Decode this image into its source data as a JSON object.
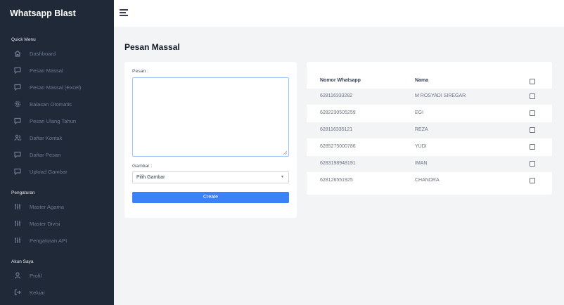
{
  "app": {
    "title": "Whatsapp Blast"
  },
  "sidebar": {
    "sections": [
      {
        "label": "Quick Menu",
        "items": [
          {
            "label": "Dashboard",
            "icon": "home-icon"
          },
          {
            "label": "Pesan Massal",
            "icon": "message-icon"
          },
          {
            "label": "Pesan Massal (Excel)",
            "icon": "message-icon"
          },
          {
            "label": "Balasan Otomatis",
            "icon": "gear-icon"
          },
          {
            "label": "Pesan Ulang Tahun",
            "icon": "message-icon"
          },
          {
            "label": "Daftar Kontak",
            "icon": "users-icon"
          },
          {
            "label": "Daftar Pesan",
            "icon": "message-icon"
          },
          {
            "label": "Upload Gambar",
            "icon": "message-icon"
          }
        ]
      },
      {
        "label": "Pengaturan",
        "items": [
          {
            "label": "Master Agama",
            "icon": "sliders-icon"
          },
          {
            "label": "Master Divisi",
            "icon": "sliders-icon"
          },
          {
            "label": "Pengaturan API",
            "icon": "sliders-icon"
          }
        ]
      },
      {
        "label": "Akun Saya",
        "items": [
          {
            "label": "Profil",
            "icon": "user-icon"
          },
          {
            "label": "Keluar",
            "icon": "logout-icon"
          }
        ]
      }
    ]
  },
  "main": {
    "title": "Pesan Massal",
    "form": {
      "message_label": "Pesan :",
      "message_value": "",
      "image_label": "Gambar :",
      "image_selected": "Pilih Gambar",
      "submit_label": "Create"
    },
    "table": {
      "columns": [
        "Nomor Whatsapp",
        "Nama"
      ],
      "rows": [
        {
          "nomor": "628116333282",
          "nama": "M ROSYADI SIREGAR"
        },
        {
          "nomor": "6282230505259",
          "nama": "EGI"
        },
        {
          "nomor": "628116335121",
          "nama": "REZA"
        },
        {
          "nomor": "6285275000786",
          "nama": "YUDI"
        },
        {
          "nomor": "6283198948191",
          "nama": "IMAN"
        },
        {
          "nomor": "628126551925",
          "nama": "CHANDRA"
        }
      ]
    }
  },
  "colors": {
    "sidebar_bg": "#1f2937",
    "accent": "#3b82f6",
    "page_bg": "#f3f4f6"
  }
}
